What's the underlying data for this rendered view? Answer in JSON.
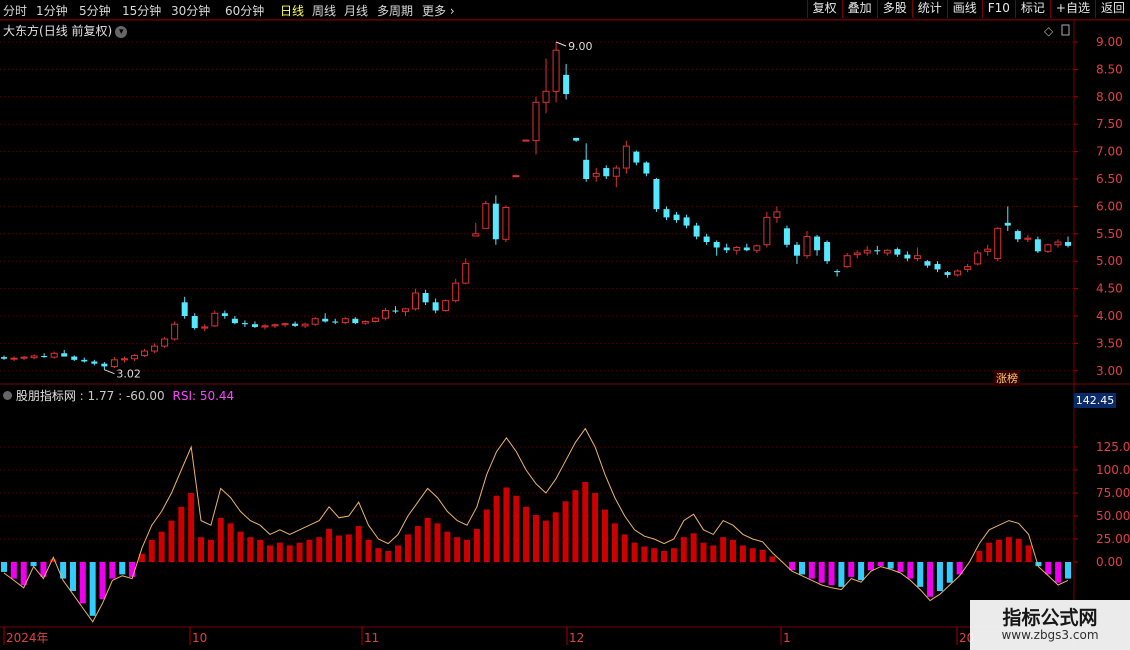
{
  "toolbar": {
    "periods": [
      "分时",
      "1分钟",
      "5分钟",
      "15分钟",
      "30分钟",
      "60分钟",
      "日线",
      "周线",
      "月线",
      "多周期",
      "更多"
    ],
    "active": "日线",
    "right_buttons": [
      "复权",
      "叠加",
      "多股",
      "统计",
      "画线",
      "F10",
      "标记",
      "+自选",
      "返回"
    ]
  },
  "chart": {
    "stock": "大东方",
    "mode": "(日线 前复权)",
    "price_axis": [
      "9.00",
      "8.50",
      "8.00",
      "7.50",
      "7.00",
      "6.50",
      "6.00",
      "5.50",
      "5.00",
      "4.50",
      "4.00",
      "3.50",
      "3.00"
    ],
    "high_label": "9.00",
    "low_label": "3.02",
    "badge": "涨榜"
  },
  "indicator": {
    "name": "股朋指标网",
    "value1": "1.77",
    "value2": "-60.00",
    "rsi_label": "RSI: 50.44",
    "axis": [
      "125.0",
      "100.0",
      "75.00",
      "50.00",
      "25.00",
      "0.00"
    ],
    "top_value": "142.45"
  },
  "dates": [
    "2024年",
    "10",
    "11",
    "12",
    "1",
    "20"
  ],
  "watermark": {
    "main": "指标公式网",
    "sub": "www.zbgs3.com"
  },
  "colors": {
    "up": "#e03030",
    "down": "#55e8ff",
    "grid": "#5a0000",
    "rsi": "#e8b46a",
    "pos": "#cc0000",
    "neg1": "#33ccff",
    "neg2": "#ee00ee"
  },
  "chart_data": {
    "type": "candlestick",
    "candles": [
      [
        3.25,
        3.28,
        3.2,
        3.22
      ],
      [
        3.22,
        3.26,
        3.18,
        3.23
      ],
      [
        3.23,
        3.27,
        3.2,
        3.25
      ],
      [
        3.24,
        3.3,
        3.21,
        3.27
      ],
      [
        3.27,
        3.32,
        3.24,
        3.25
      ],
      [
        3.25,
        3.35,
        3.22,
        3.32
      ],
      [
        3.32,
        3.38,
        3.28,
        3.26
      ],
      [
        3.26,
        3.28,
        3.18,
        3.2
      ],
      [
        3.2,
        3.24,
        3.15,
        3.17
      ],
      [
        3.17,
        3.2,
        3.1,
        3.13
      ],
      [
        3.13,
        3.16,
        3.02,
        3.08
      ],
      [
        3.08,
        3.25,
        3.05,
        3.2
      ],
      [
        3.2,
        3.26,
        3.15,
        3.22
      ],
      [
        3.22,
        3.3,
        3.18,
        3.28
      ],
      [
        3.28,
        3.4,
        3.25,
        3.36
      ],
      [
        3.36,
        3.5,
        3.32,
        3.45
      ],
      [
        3.45,
        3.62,
        3.42,
        3.58
      ],
      [
        3.58,
        3.9,
        3.55,
        3.85
      ],
      [
        4.25,
        4.35,
        3.95,
        4.0
      ],
      [
        4.0,
        4.05,
        3.75,
        3.78
      ],
      [
        3.78,
        3.85,
        3.72,
        3.8
      ],
      [
        3.82,
        4.1,
        3.8,
        4.05
      ],
      [
        4.05,
        4.1,
        3.95,
        4.0
      ],
      [
        3.95,
        4.0,
        3.85,
        3.87
      ],
      [
        3.87,
        3.92,
        3.8,
        3.85
      ],
      [
        3.85,
        3.9,
        3.78,
        3.8
      ],
      [
        3.8,
        3.85,
        3.75,
        3.82
      ],
      [
        3.82,
        3.86,
        3.78,
        3.84
      ],
      [
        3.84,
        3.88,
        3.8,
        3.86
      ],
      [
        3.86,
        3.9,
        3.8,
        3.82
      ],
      [
        3.82,
        3.88,
        3.78,
        3.85
      ],
      [
        3.85,
        3.98,
        3.82,
        3.95
      ],
      [
        3.95,
        4.05,
        3.88,
        3.9
      ],
      [
        3.9,
        3.95,
        3.85,
        3.88
      ],
      [
        3.88,
        3.98,
        3.85,
        3.95
      ],
      [
        3.95,
        3.98,
        3.85,
        3.87
      ],
      [
        3.87,
        3.92,
        3.84,
        3.9
      ],
      [
        3.9,
        3.98,
        3.88,
        3.96
      ],
      [
        3.96,
        4.15,
        3.92,
        4.1
      ],
      [
        4.1,
        4.18,
        4.05,
        4.08
      ],
      [
        4.08,
        4.15,
        4.0,
        4.13
      ],
      [
        4.13,
        4.5,
        4.1,
        4.42
      ],
      [
        4.42,
        4.48,
        4.2,
        4.25
      ],
      [
        4.25,
        4.32,
        4.05,
        4.1
      ],
      [
        4.1,
        4.3,
        4.08,
        4.28
      ],
      [
        4.28,
        4.68,
        4.25,
        4.6
      ],
      [
        4.6,
        5.05,
        4.58,
        4.96
      ],
      [
        5.46,
        5.7,
        5.46,
        5.5
      ],
      [
        5.6,
        6.1,
        5.6,
        6.05
      ],
      [
        6.05,
        6.2,
        5.3,
        5.4
      ],
      [
        5.4,
        6.02,
        5.35,
        5.98
      ],
      [
        6.55,
        6.58,
        6.55,
        6.56
      ],
      [
        7.2,
        7.22,
        7.2,
        7.21
      ],
      [
        7.2,
        8.0,
        6.95,
        7.9
      ],
      [
        7.9,
        8.7,
        7.7,
        8.1
      ],
      [
        8.1,
        9.0,
        7.9,
        8.85
      ],
      [
        8.4,
        8.6,
        7.95,
        8.05
      ],
      [
        7.25,
        7.25,
        7.18,
        7.2
      ],
      [
        6.85,
        7.15,
        6.45,
        6.5
      ],
      [
        6.55,
        6.7,
        6.45,
        6.6
      ],
      [
        6.7,
        6.75,
        6.5,
        6.55
      ],
      [
        6.55,
        6.75,
        6.35,
        6.7
      ],
      [
        6.7,
        7.2,
        6.6,
        7.1
      ],
      [
        7.0,
        7.02,
        6.75,
        6.8
      ],
      [
        6.8,
        6.82,
        6.55,
        6.6
      ],
      [
        6.5,
        6.52,
        5.9,
        5.95
      ],
      [
        5.95,
        6.0,
        5.75,
        5.8
      ],
      [
        5.85,
        5.9,
        5.7,
        5.75
      ],
      [
        5.8,
        5.85,
        5.6,
        5.65
      ],
      [
        5.65,
        5.7,
        5.4,
        5.45
      ],
      [
        5.45,
        5.5,
        5.3,
        5.35
      ],
      [
        5.35,
        5.38,
        5.1,
        5.25
      ],
      [
        5.25,
        5.32,
        5.15,
        5.2
      ],
      [
        5.2,
        5.28,
        5.12,
        5.25
      ],
      [
        5.25,
        5.32,
        5.18,
        5.2
      ],
      [
        5.2,
        5.3,
        5.15,
        5.28
      ],
      [
        5.3,
        5.9,
        5.25,
        5.8
      ],
      [
        5.8,
        6.0,
        5.7,
        5.9
      ],
      [
        5.6,
        5.65,
        5.25,
        5.3
      ],
      [
        5.3,
        5.35,
        4.95,
        5.1
      ],
      [
        5.1,
        5.55,
        5.05,
        5.45
      ],
      [
        5.45,
        5.48,
        5.1,
        5.2
      ],
      [
        5.35,
        5.38,
        4.95,
        5.0
      ],
      [
        4.82,
        4.85,
        4.72,
        4.8
      ],
      [
        4.9,
        5.15,
        4.88,
        5.1
      ],
      [
        5.12,
        5.2,
        5.05,
        5.15
      ],
      [
        5.15,
        5.28,
        5.1,
        5.2
      ],
      [
        5.2,
        5.28,
        5.12,
        5.18
      ],
      [
        5.15,
        5.22,
        5.1,
        5.2
      ],
      [
        5.22,
        5.25,
        5.08,
        5.12
      ],
      [
        5.12,
        5.18,
        5.0,
        5.05
      ],
      [
        5.05,
        5.25,
        5.0,
        5.1
      ],
      [
        5.0,
        5.02,
        4.88,
        4.92
      ],
      [
        4.95,
        5.0,
        4.8,
        4.85
      ],
      [
        4.8,
        4.82,
        4.7,
        4.75
      ],
      [
        4.75,
        4.85,
        4.72,
        4.82
      ],
      [
        4.85,
        4.95,
        4.8,
        4.9
      ],
      [
        4.95,
        5.2,
        4.92,
        5.15
      ],
      [
        5.18,
        5.3,
        5.1,
        5.22
      ],
      [
        5.05,
        5.62,
        5.0,
        5.6
      ],
      [
        5.7,
        6.0,
        5.55,
        5.65
      ],
      [
        5.55,
        5.58,
        5.35,
        5.4
      ],
      [
        5.4,
        5.48,
        5.35,
        5.42
      ],
      [
        5.4,
        5.45,
        5.15,
        5.18
      ],
      [
        5.18,
        5.32,
        5.15,
        5.3
      ],
      [
        5.3,
        5.4,
        5.25,
        5.35
      ],
      [
        5.35,
        5.45,
        5.25,
        5.28
      ]
    ],
    "rsi": [
      -12,
      -20,
      -28,
      -5,
      -18,
      5,
      -20,
      -35,
      -50,
      -65,
      -45,
      -20,
      -15,
      -18,
      15,
      40,
      55,
      75,
      100,
      125,
      45,
      40,
      80,
      70,
      55,
      45,
      40,
      30,
      35,
      30,
      35,
      40,
      45,
      60,
      48,
      50,
      65,
      40,
      25,
      20,
      30,
      50,
      65,
      80,
      70,
      55,
      45,
      40,
      60,
      95,
      120,
      135,
      120,
      100,
      85,
      75,
      90,
      110,
      130,
      145,
      125,
      95,
      70,
      50,
      35,
      28,
      25,
      20,
      25,
      45,
      52,
      35,
      30,
      45,
      40,
      30,
      25,
      22,
      10,
      0,
      -10,
      -15,
      -20,
      -25,
      -28,
      -30,
      -18,
      -22,
      -10,
      -5,
      -8,
      -12,
      -20,
      -30,
      -42,
      -35,
      -25,
      -15,
      0,
      20,
      35,
      40,
      45,
      42,
      30,
      -5,
      -15,
      -25,
      -20
    ]
  }
}
